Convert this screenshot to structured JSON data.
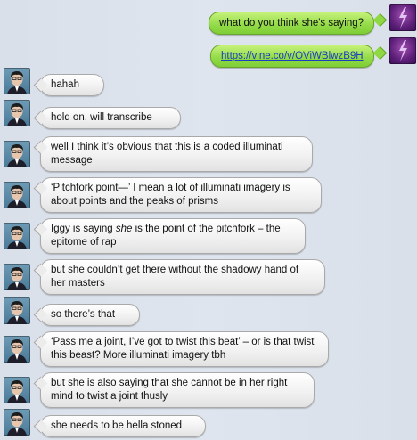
{
  "outgoing": [
    {
      "text": "what do you think she's saying?"
    },
    {
      "text": "https://vine.co/v/OViWBlwzB9H"
    }
  ],
  "incoming": [
    {
      "parts": [
        {
          "t": "hahah"
        }
      ]
    },
    {
      "parts": [
        {
          "t": "hold on, will transcribe"
        }
      ]
    },
    {
      "parts": [
        {
          "t": "well I think it’s obvious that this is a coded illuminati message"
        }
      ]
    },
    {
      "parts": [
        {
          "t": "‘Pitchfork point—’ I mean a lot of illuminati imagery is about points and the peaks of prisms"
        }
      ]
    },
    {
      "parts": [
        {
          "t": "Iggy is saying "
        },
        {
          "t": "she",
          "em": true
        },
        {
          "t": " is the point of the pitchfork – the epitome of rap"
        }
      ]
    },
    {
      "parts": [
        {
          "t": "but she couldn’t get there without the shadowy hand of her masters"
        }
      ]
    },
    {
      "parts": [
        {
          "t": "so there’s that"
        }
      ]
    },
    {
      "parts": [
        {
          "t": "‘Pass me a joint, I’ve got to twist this beat’ – or is that twist this beast? More illuminati imagery tbh"
        }
      ]
    },
    {
      "parts": [
        {
          "t": "but she is also saying that she cannot be in her right mind to twist a joint thusly"
        }
      ]
    },
    {
      "parts": [
        {
          "t": "she needs to be hella stoned"
        }
      ]
    }
  ],
  "colors": {
    "outgoing_bubble": "#95dc4a",
    "incoming_bubble": "#f0f0f0",
    "link": "#1a3fbf"
  },
  "icons": {
    "me_avatar": "purple-lightning-avatar-icon",
    "them_avatar": "person-photo-avatar-icon"
  }
}
